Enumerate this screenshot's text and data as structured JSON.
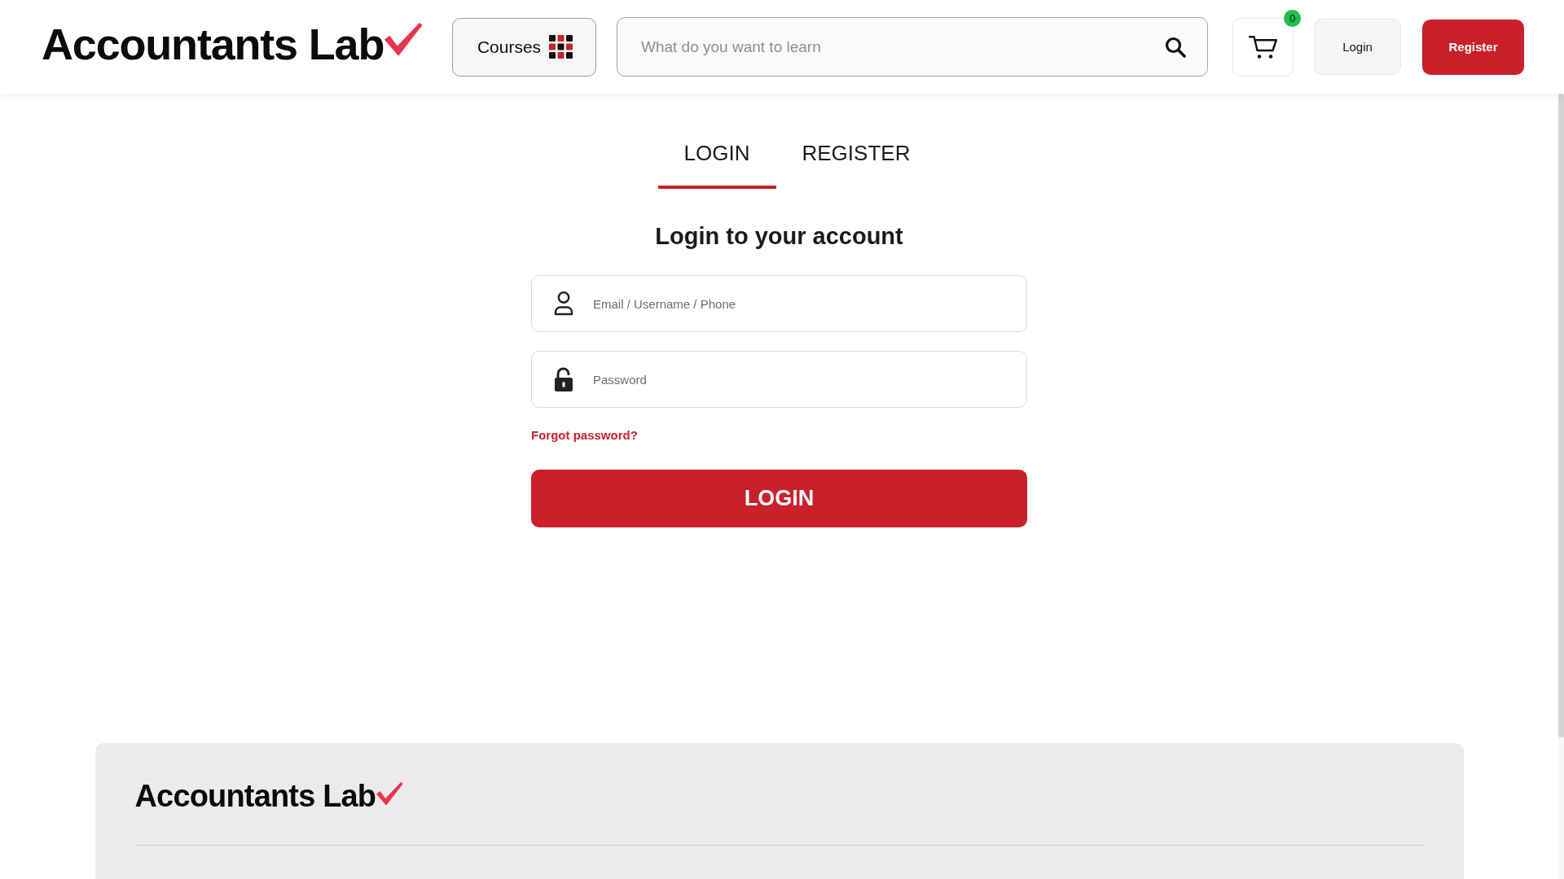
{
  "header": {
    "logo": {
      "text": "Accountants Lab"
    },
    "courses_button": {
      "label": "Courses"
    },
    "search": {
      "placeholder": "What do you want to learn"
    },
    "cart": {
      "count": "0"
    },
    "buttons": [
      {
        "label": "Login",
        "kind": "secondary"
      },
      {
        "label": "Register",
        "kind": "primary"
      }
    ]
  },
  "tabs": [
    {
      "label": "LOGIN",
      "selected": true
    },
    {
      "label": "REGISTER",
      "selected": false
    }
  ],
  "form": {
    "title": "Login to your account",
    "fields": [
      {
        "kind": "text",
        "placeholder": "Email / Username / Phone"
      },
      {
        "kind": "password",
        "placeholder": "Password"
      }
    ],
    "forgot_link": "Forgot password?",
    "submit": "LOGIN"
  },
  "footer": {
    "logo": {
      "text": "Accountants Lab"
    }
  }
}
